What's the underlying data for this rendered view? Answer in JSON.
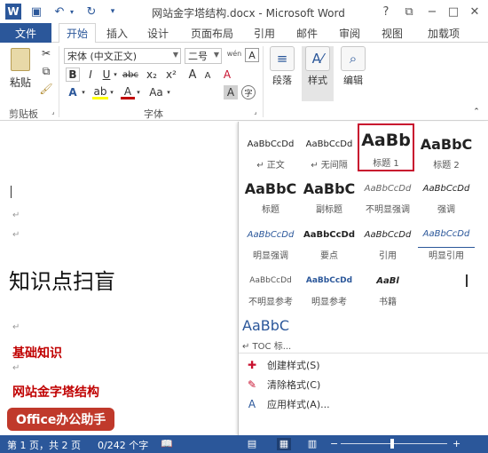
{
  "titlebar": {
    "title": "网站金字塔结构.docx - Microsoft Word",
    "help": "?",
    "restore": "⧉",
    "minimize": "−",
    "maximize": "□",
    "close": "✕"
  },
  "tabs": {
    "file": "文件",
    "items": [
      "开始",
      "插入",
      "设计",
      "页面布局",
      "引用",
      "邮件",
      "审阅",
      "视图",
      "加载项"
    ]
  },
  "ribbon": {
    "clipboard_label": "剪贴板",
    "paste_label": "粘贴",
    "font_label": "字体",
    "font_name": "宋体 (中文正文)",
    "font_size": "二号",
    "paragraph_label": "段落",
    "styles_label": "样式",
    "editing_label": "编辑",
    "bold": "B",
    "italic": "I",
    "underline": "U",
    "strike": "abc",
    "subscript": "x₂",
    "superscript": "x²",
    "change_case": "Aa",
    "grow": "A",
    "shrink": "A",
    "clear": "A",
    "phonetic": "wén",
    "border_char": "A",
    "shade_char": "A",
    "font_color": "A",
    "highlight": "ab"
  },
  "document": {
    "heading": "知识点扫盲",
    "red1": "基础知识",
    "red2": "网站金字塔结构",
    "badge": "Office办公助手"
  },
  "gallery": {
    "styles": [
      {
        "sample": "AaBbCcDd",
        "name": "↵ 正文"
      },
      {
        "sample": "AaBbCcDd",
        "name": "↵ 无间隔"
      },
      {
        "sample": "AaBb",
        "name": "标题 1"
      },
      {
        "sample": "AaBbC",
        "name": "标题 2"
      },
      {
        "sample": "AaBbC",
        "name": "标题"
      },
      {
        "sample": "AaBbC",
        "name": "副标题"
      },
      {
        "sample": "AaBbCcDd",
        "name": "不明显强调"
      },
      {
        "sample": "AaBbCcDd",
        "name": "强调"
      },
      {
        "sample": "AaBbCcDd",
        "name": "明显强调"
      },
      {
        "sample": "AaBbCcDd",
        "name": "要点"
      },
      {
        "sample": "AaBbCcDd",
        "name": "引用"
      },
      {
        "sample": "AaBbCcDd",
        "name": "明显引用"
      },
      {
        "sample": "AaBbCcDd",
        "name": "不明显参考"
      },
      {
        "sample": "AaBbCcDd",
        "name": "明显参考"
      },
      {
        "sample": "AaBl",
        "name": "书籍"
      },
      {
        "sample": "AaBbC",
        "name": "↵ TOC 标..."
      }
    ],
    "menu": [
      "创建样式(S)",
      "清除格式(C)",
      "应用样式(A)..."
    ]
  },
  "status": {
    "page": "第 1 页，共 2 页",
    "words": "0/242 个字"
  },
  "colors": {
    "accent": "#2b579a",
    "selected_border": "#c8102e",
    "red_text": "#c00000",
    "badge": "#c0392b"
  }
}
